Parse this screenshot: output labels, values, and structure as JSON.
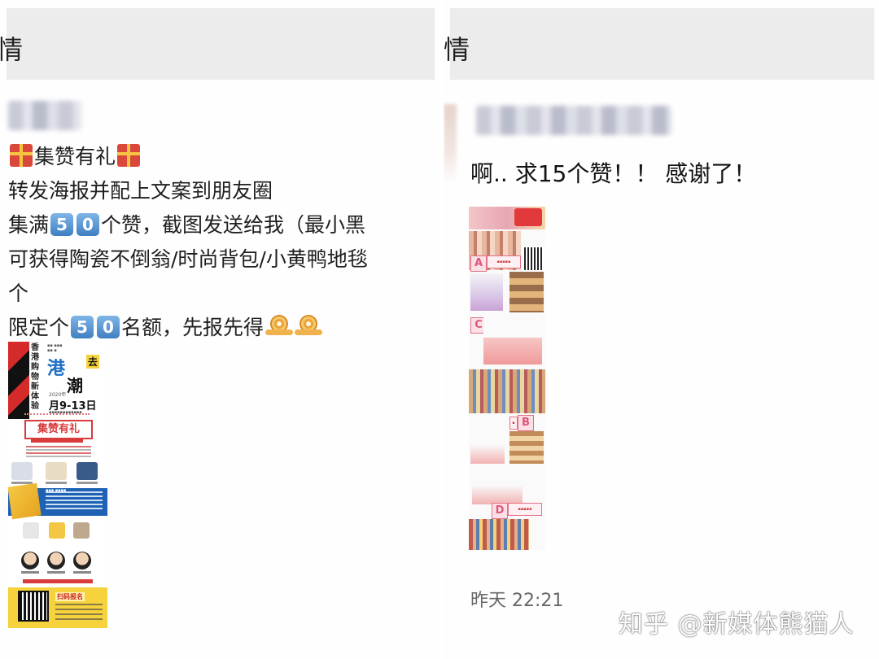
{
  "left": {
    "header_title": "情",
    "post": {
      "title": "集赞有礼",
      "line2": "转发海报并配上文案到朋友圈",
      "line3_prefix": "集满",
      "line3_digits": [
        "5",
        "0"
      ],
      "line3_suffix": "个赞，截图发送给我（最小黑",
      "line4": "可获得陶瓷不倒翁/时尚背包/小黄鸭地毯",
      "line5": "个",
      "line6_prefix": "限定个",
      "line6_digits": [
        "5",
        "0"
      ],
      "line6_suffix": "名额，先报先得"
    },
    "poster": {
      "vertical_text": "香港购物新体验",
      "big_text": "港",
      "big_text2": "潮",
      "go_text": "去",
      "year": "2020年",
      "dates": "月9-13日",
      "banner": "集赞有礼",
      "bottom_title": "扫码报名"
    }
  },
  "right": {
    "header_title": "情",
    "message": "啊.. 求15个赞！！ 感谢了！",
    "collage_tags": [
      "A",
      "C",
      "B",
      "D"
    ],
    "timestamp": "昨天 22:21"
  },
  "watermark": "知乎 @新媒体熊猫人",
  "colors": {
    "header_bg": "#ececec",
    "digit_badge": "#3f7fc2",
    "poster_red": "#d93a3a",
    "poster_blue": "#1e62b3",
    "poster_yellow": "#f6d23d",
    "collage_pink": "#e46f86"
  },
  "icons": [
    "gift-icon",
    "digit-badge",
    "snail-emoji"
  ]
}
